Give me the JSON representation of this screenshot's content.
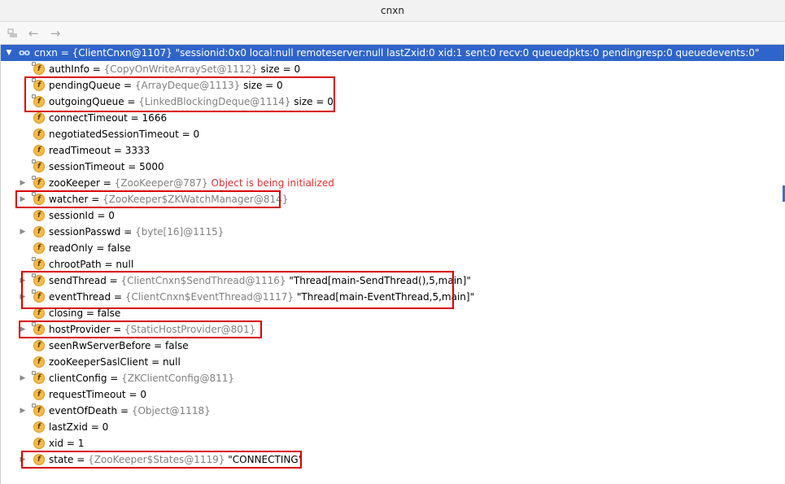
{
  "window": {
    "title": "cnxn"
  },
  "toolbar": {
    "restore_icon": "restore-layout-icon",
    "back_icon": "arrow-left-icon",
    "forward_icon": "arrow-right-icon"
  },
  "root": {
    "text": "cnxn = {ClientCnxn@1107} \"sessionid:0x0 local:null remoteserver:null lastZxid:0 xid:1 sent:0 recv:0 queuedpkts:0 pendingresp:0 queuedevents:0\""
  },
  "fields": [
    {
      "name": "authInfo",
      "value": "{CopyOnWriteArraySet@1112}",
      "extra": "size = 0",
      "expandable": false,
      "locked": true
    },
    {
      "name": "pendingQueue",
      "value": "{ArrayDeque@1113}",
      "extra": "size = 0",
      "expandable": false,
      "locked": true
    },
    {
      "name": "outgoingQueue",
      "value": "{LinkedBlockingDeque@1114}",
      "extra": "size = 0",
      "expandable": false,
      "locked": true
    },
    {
      "name": "connectTimeout",
      "value": "1666",
      "extra": "",
      "expandable": false,
      "locked": false
    },
    {
      "name": "negotiatedSessionTimeout",
      "value": "0",
      "extra": "",
      "expandable": false,
      "locked": false
    },
    {
      "name": "readTimeout",
      "value": "3333",
      "extra": "",
      "expandable": false,
      "locked": false
    },
    {
      "name": "sessionTimeout",
      "value": "5000",
      "extra": "",
      "expandable": false,
      "locked": true
    },
    {
      "name": "zooKeeper",
      "value": "{ZooKeeper@787}",
      "extra": "Object is being initialized",
      "expandable": true,
      "locked": true
    },
    {
      "name": "watcher",
      "value": "{ZooKeeper$ZKWatchManager@814}",
      "extra": "",
      "expandable": true,
      "locked": true
    },
    {
      "name": "sessionId",
      "value": "0",
      "extra": "",
      "expandable": false,
      "locked": false
    },
    {
      "name": "sessionPasswd",
      "value": "{byte[16]@1115}",
      "extra": "",
      "expandable": true,
      "locked": false
    },
    {
      "name": "readOnly",
      "value": "false",
      "extra": "",
      "expandable": false,
      "locked": false
    },
    {
      "name": "chrootPath",
      "value": "null",
      "extra": "",
      "expandable": false,
      "locked": true
    },
    {
      "name": "sendThread",
      "value": "{ClientCnxn$SendThread@1116}",
      "extra": "\"Thread[main-SendThread(),5,main]\"",
      "expandable": true,
      "locked": true
    },
    {
      "name": "eventThread",
      "value": "{ClientCnxn$EventThread@1117}",
      "extra": "\"Thread[main-EventThread,5,main]\"",
      "expandable": true,
      "locked": true
    },
    {
      "name": "closing",
      "value": "false",
      "extra": "",
      "expandable": false,
      "locked": false
    },
    {
      "name": "hostProvider",
      "value": "{StaticHostProvider@801}",
      "extra": "",
      "expandable": true,
      "locked": true
    },
    {
      "name": "seenRwServerBefore",
      "value": "false",
      "extra": "",
      "expandable": false,
      "locked": false
    },
    {
      "name": "zooKeeperSaslClient",
      "value": "null",
      "extra": "",
      "expandable": false,
      "locked": false
    },
    {
      "name": "clientConfig",
      "value": "{ZKClientConfig@811}",
      "extra": "",
      "expandable": true,
      "locked": true
    },
    {
      "name": "requestTimeout",
      "value": "0",
      "extra": "",
      "expandable": false,
      "locked": false
    },
    {
      "name": "eventOfDeath",
      "value": "{Object@1118}",
      "extra": "",
      "expandable": true,
      "locked": true
    },
    {
      "name": "lastZxid",
      "value": "0",
      "extra": "",
      "expandable": false,
      "locked": false
    },
    {
      "name": "xid",
      "value": "1",
      "extra": "",
      "expandable": false,
      "locked": false
    },
    {
      "name": "state",
      "value": "{ZooKeeper$States@1119}",
      "extra": "\"CONNECTING\"",
      "expandable": true,
      "locked": false
    }
  ],
  "colors": {
    "selection": "#2f65ca",
    "highlight_box": "#d90000",
    "error_text": "#e03131",
    "reference_text": "#808080"
  }
}
